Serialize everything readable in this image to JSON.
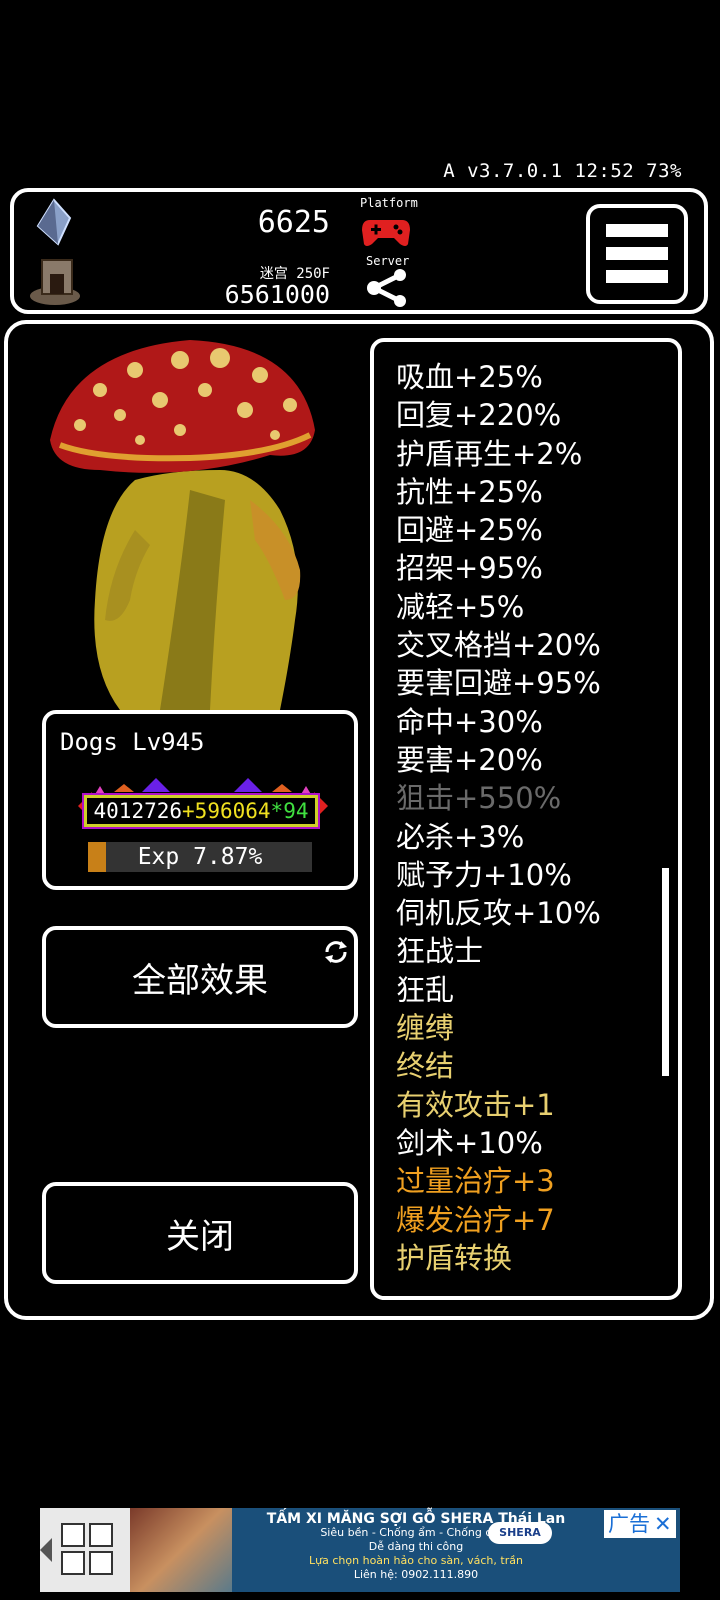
{
  "status": {
    "text": "A v3.7.0.1 12:52 73%"
  },
  "header": {
    "gold": "6625",
    "maze_label": "迷宫 250F",
    "maze_value": "6561000",
    "platform_label": "Platform",
    "server_label": "Server"
  },
  "player": {
    "name": "Dogs Lv945",
    "hp_base": "4012726",
    "hp_plus": "+596064",
    "hp_mult": "*94",
    "exp_label": "Exp 7.87%",
    "exp_fraction": 0.0787
  },
  "buttons": {
    "all_effects": "全部效果",
    "close": "关闭"
  },
  "effects": [
    {
      "text": "吸血+25%",
      "color": "#ffffff"
    },
    {
      "text": "回复+220%",
      "color": "#ffffff"
    },
    {
      "text": "护盾再生+2%",
      "color": "#ffffff"
    },
    {
      "text": "抗性+25%",
      "color": "#ffffff"
    },
    {
      "text": "回避+25%",
      "color": "#ffffff"
    },
    {
      "text": "招架+95%",
      "color": "#ffffff"
    },
    {
      "text": "减轻+5%",
      "color": "#ffffff"
    },
    {
      "text": "交叉格挡+20%",
      "color": "#ffffff"
    },
    {
      "text": "要害回避+95%",
      "color": "#ffffff"
    },
    {
      "text": "命中+30%",
      "color": "#ffffff"
    },
    {
      "text": "要害+20%",
      "color": "#ffffff"
    },
    {
      "text": "狙击+550%",
      "color": "#6a6a6a"
    },
    {
      "text": "必杀+3%",
      "color": "#ffffff"
    },
    {
      "text": "赋予力+10%",
      "color": "#ffffff"
    },
    {
      "text": "伺机反攻+10%",
      "color": "#ffffff"
    },
    {
      "text": "狂战士",
      "color": "#ffffff"
    },
    {
      "text": "狂乱",
      "color": "#ffffff"
    },
    {
      "text": "缠缚",
      "color": "#e8d070"
    },
    {
      "text": "终结",
      "color": "#e8d070"
    },
    {
      "text": "有效攻击+1",
      "color": "#e8d070"
    },
    {
      "text": "剑术+10%",
      "color": "#ffffff"
    },
    {
      "text": "过量治疗+3",
      "color": "#f0a020"
    },
    {
      "text": "爆发治疗+7",
      "color": "#f0a020"
    },
    {
      "text": "护盾转换",
      "color": "#e8d070"
    }
  ],
  "ad": {
    "title": "TẤM XI MĂNG SỢI GỖ SHERA Thái Lan",
    "line2": "Siêu bền - Chống ẩm - Chống cháy",
    "line3": "Dễ dàng thi công",
    "line4": "Lựa chọn hoàn hảo cho sàn, vách, trần",
    "phone": "Liên hệ: 0902.111.890",
    "brand": "SHERA",
    "tag": "广告",
    "close": "✕"
  }
}
